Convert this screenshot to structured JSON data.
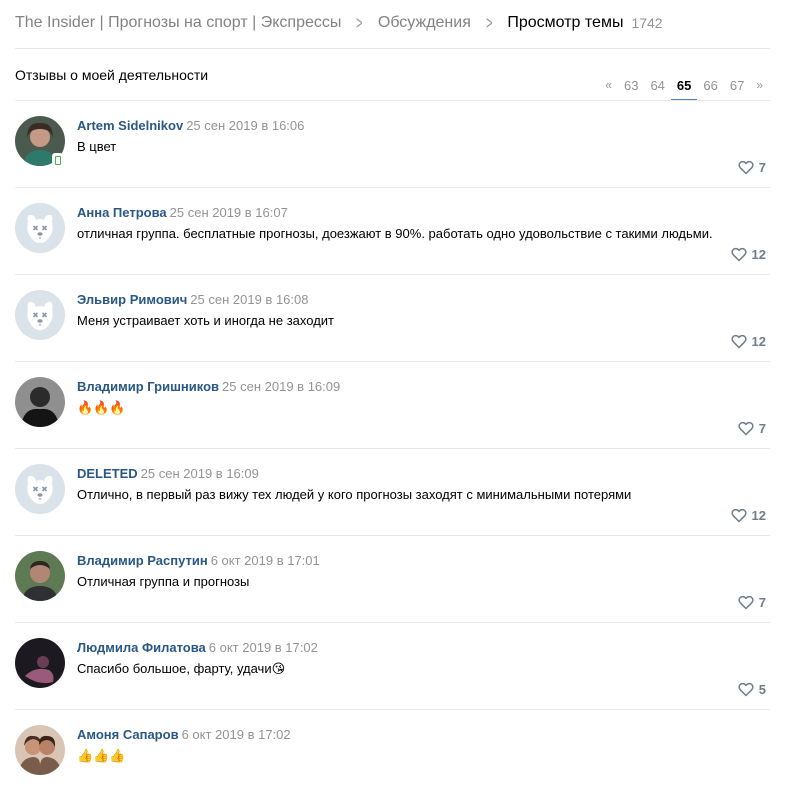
{
  "breadcrumbs": {
    "group": "The Insider | Прогнозы на спорт | Экспрессы",
    "discussions": "Обсуждения",
    "current": "Просмотр темы",
    "count": "1742"
  },
  "topic": {
    "title": "Отзывы о моей деятельности"
  },
  "pager": {
    "prev": "«",
    "pages": [
      "63",
      "64",
      "65",
      "66",
      "67"
    ],
    "active": "65",
    "next": "»"
  },
  "comments": [
    {
      "author": "Artem Sidelnikov",
      "date": "25 сен 2019 в 16:06",
      "text": "В цвет",
      "likes": "7",
      "avatar": "photo-woman",
      "mobile": true
    },
    {
      "author": "Анна Петрова",
      "date": "25 сен 2019 в 16:07",
      "text": "отличная группа. бесплатные прогнозы, доезжают в 90%. работать одно удовольствие с такими людьми.",
      "likes": "12",
      "avatar": "deactivated-dog-icon"
    },
    {
      "author": "Эльвир Римович",
      "date": "25 сен 2019 в 16:08",
      "text": "Меня устраивает хоть и иногда не заходит",
      "likes": "12",
      "avatar": "deactivated-dog-icon"
    },
    {
      "author": "Владимир Гришников",
      "date": "25 сен 2019 в 16:09",
      "text": "🔥🔥🔥",
      "likes": "7",
      "avatar": "photo-dark"
    },
    {
      "author": "DELETED",
      "date": "25 сен 2019 в 16:09",
      "text": "Отлично, в первый раз вижу тех людей у кого прогнозы заходят с минимальными потерями",
      "likes": "12",
      "avatar": "deactivated-dog-icon"
    },
    {
      "author": "Владимир Распутин",
      "date": "6 окт 2019 в 17:01",
      "text": "Отличная группа и прогнозы",
      "likes": "7",
      "avatar": "photo-man"
    },
    {
      "author": "Людмила Филатова",
      "date": "6 окт 2019 в 17:02",
      "text": "Спасибо большое, фарту, удачи😘",
      "likes": "5",
      "avatar": "photo-dark-pink"
    },
    {
      "author": "Амоня Сапаров",
      "date": "6 окт 2019 в 17:02",
      "text": "👍👍👍",
      "likes": "",
      "avatar": "photo-couple"
    }
  ],
  "colors": {
    "link": "#2a5885",
    "muted": "#939393",
    "divider": "#e7e8ec",
    "accent": "#5181b8"
  }
}
